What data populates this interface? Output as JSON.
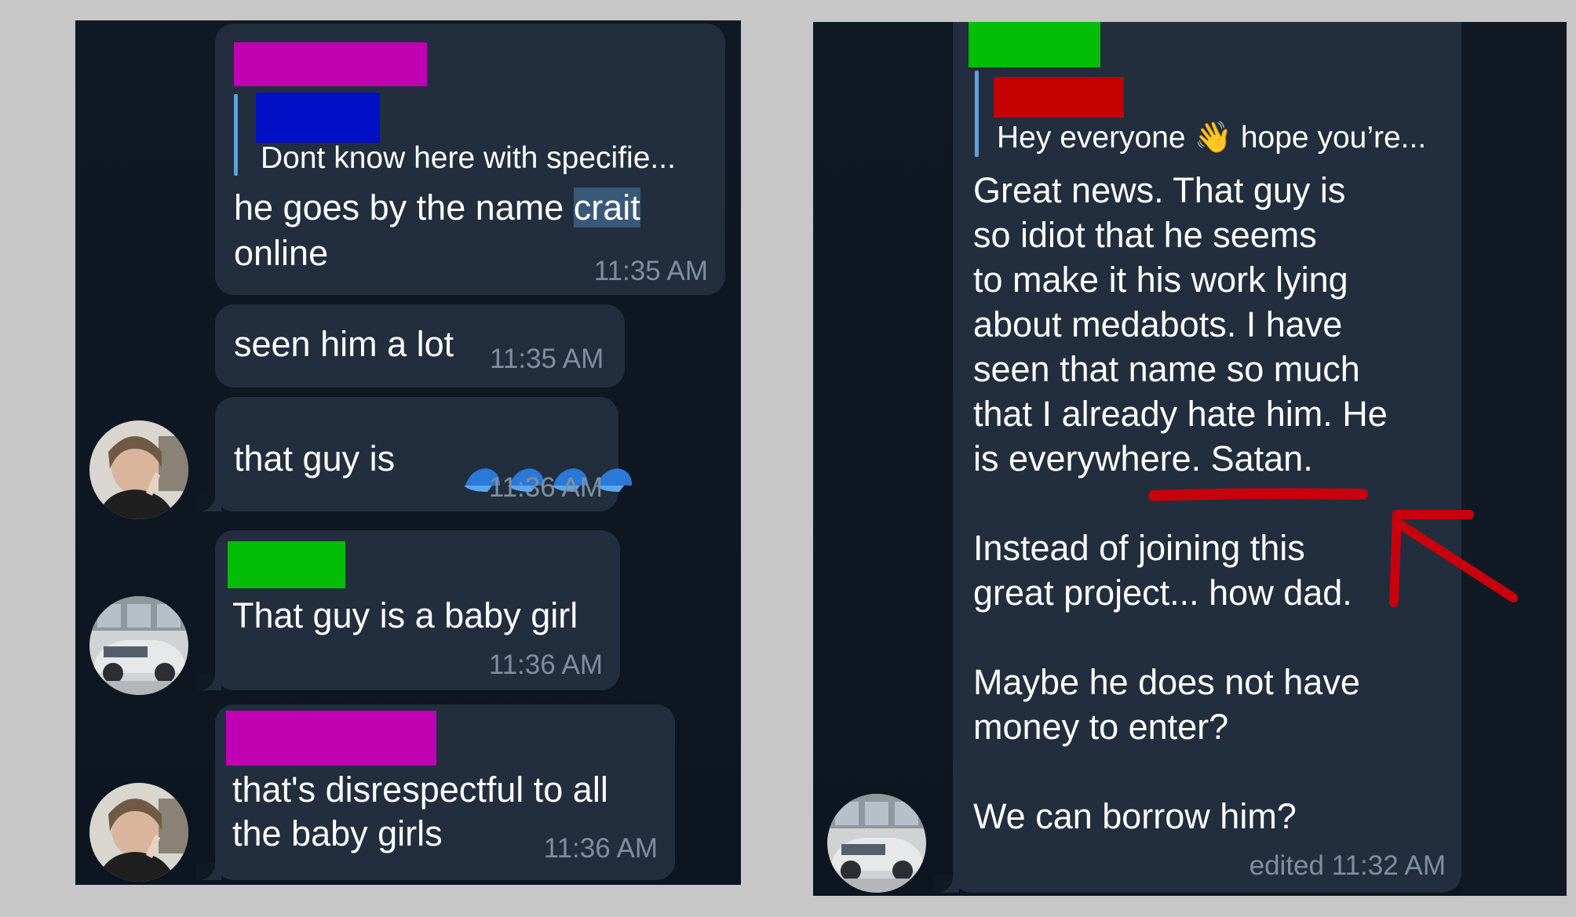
{
  "left_chat": {
    "messages": [
      {
        "sender_color": "#c100b4",
        "quote": {
          "author_color": "#0010c4",
          "text": "Dont know here with specifie..."
        },
        "text_part1": "he goes by the name ",
        "text_highlight": "crait",
        "text_line2": "online",
        "time": "11:35 AM"
      },
      {
        "text": "seen him a lot",
        "time": "11:35 AM"
      },
      {
        "text": "that guy is",
        "emoji": "cap-icon x4",
        "time": "11:36 AM"
      },
      {
        "sender_color": "#03bd06",
        "text": "That guy is a baby girl",
        "time": "11:36 AM"
      },
      {
        "sender_color": "#c100b4",
        "text_line1": "that's disrespectful to all",
        "text_line2": "the baby girls",
        "time": "11:36 AM"
      }
    ]
  },
  "right_chat": {
    "message": {
      "sender_color": "#03bd06",
      "quote": {
        "author_color": "#c40000",
        "text_before": "Hey everyone ",
        "emoji": "👋",
        "text_after": " hope you’re..."
      },
      "lines": [
        "Great news. That guy is",
        "so idiot that he seems",
        "to make it his work lying",
        "about medabots. I have",
        "seen that name so much",
        "that I already hate him. He",
        "is everywhere. Satan.",
        "",
        "Instead of joining this",
        "great project... how dad.",
        "",
        "Maybe he does not have",
        "money to enter?",
        "",
        "We can borrow him?"
      ],
      "time": "edited 11:32 AM"
    },
    "annotation_color": "#c8000c"
  }
}
